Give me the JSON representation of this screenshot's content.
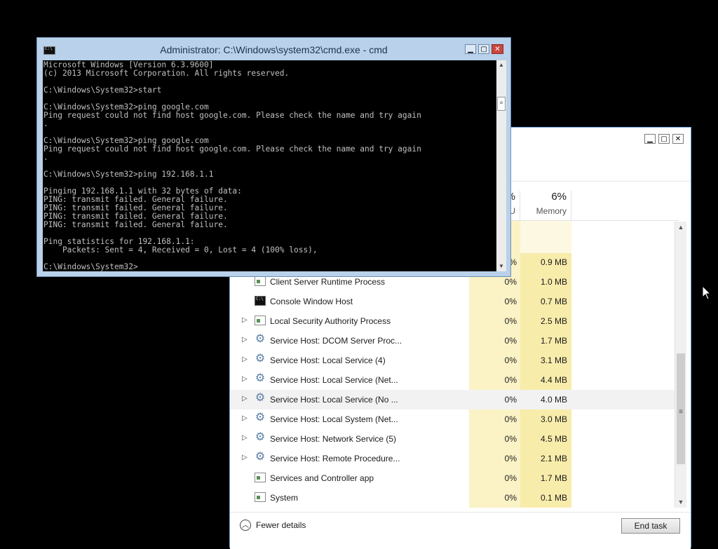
{
  "cmd_window": {
    "title": "Administrator: C:\\Windows\\system32\\cmd.exe - cmd",
    "buttons": {
      "minimize": "▁",
      "maximize": "▢",
      "close": "✕"
    },
    "console_text": "Microsoft Windows [Version 6.3.9600]\n(c) 2013 Microsoft Corporation. All rights reserved.\n\nC:\\Windows\\System32>start\n\nC:\\Windows\\System32>ping google.com\nPing request could not find host google.com. Please check the name and try again\n.\n\nC:\\Windows\\System32>ping google.com\nPing request could not find host google.com. Please check the name and try again\n.\n\nC:\\Windows\\System32>ping 192.168.1.1\n\nPinging 192.168.1.1 with 32 bytes of data:\nPING: transmit failed. General failure.\nPING: transmit failed. General failure.\nPING: transmit failed. General failure.\nPING: transmit failed. General failure.\n\nPing statistics for 192.168.1.1:\n    Packets: Sent = 4, Received = 0, Lost = 4 (100% loss),\n\nC:\\Windows\\System32>",
    "scroll_up": "▲",
    "scroll_down": "▼",
    "scroll_grip": "≡"
  },
  "task_manager": {
    "buttons": {
      "minimize": "▁",
      "maximize": "▢",
      "close": "✕"
    },
    "columns": {
      "cpu": {
        "percent": "%",
        "label": "U"
      },
      "memory": {
        "percent": "6%",
        "label": "Memory"
      }
    },
    "processes": [
      {
        "name": "",
        "cpu": "%",
        "memory": "0.9 MB",
        "icon": "none",
        "expandable": false
      },
      {
        "name": "Client Server Runtime Process",
        "cpu": "0%",
        "memory": "1.0 MB",
        "icon": "window-icon",
        "expandable": false
      },
      {
        "name": "Console Window Host",
        "cpu": "0%",
        "memory": "0.7 MB",
        "icon": "console-icon",
        "expandable": false
      },
      {
        "name": "Local Security Authority Process",
        "cpu": "0%",
        "memory": "2.5 MB",
        "icon": "window-icon",
        "expandable": true
      },
      {
        "name": "Service Host: DCOM Server Proc...",
        "cpu": "0%",
        "memory": "1.7 MB",
        "icon": "gear-icon",
        "expandable": true
      },
      {
        "name": "Service Host: Local Service (4)",
        "cpu": "0%",
        "memory": "3.1 MB",
        "icon": "gear-icon",
        "expandable": true
      },
      {
        "name": "Service Host: Local Service (Net...",
        "cpu": "0%",
        "memory": "4.4 MB",
        "icon": "gear-icon",
        "expandable": true
      },
      {
        "name": "Service Host: Local Service (No ...",
        "cpu": "0%",
        "memory": "4.0 MB",
        "icon": "gear-icon",
        "expandable": true
      },
      {
        "name": "Service Host: Local System (Net...",
        "cpu": "0%",
        "memory": "3.0 MB",
        "icon": "gear-icon",
        "expandable": true
      },
      {
        "name": "Service Host: Network Service (5)",
        "cpu": "0%",
        "memory": "4.5 MB",
        "icon": "gear-icon",
        "expandable": true
      },
      {
        "name": "Service Host: Remote Procedure...",
        "cpu": "0%",
        "memory": "2.1 MB",
        "icon": "gear-icon",
        "expandable": true
      },
      {
        "name": "Services and Controller app",
        "cpu": "0%",
        "memory": "1.7 MB",
        "icon": "window-icon",
        "expandable": false
      },
      {
        "name": "System",
        "cpu": "0%",
        "memory": "0.1 MB",
        "icon": "window-icon",
        "expandable": false
      }
    ],
    "highlighted_row": 7,
    "expander_glyph": "▷",
    "fewer_details_icon": "︿",
    "fewer_details": "Fewer details",
    "end_task": "End task",
    "scroll_up": "▲",
    "scroll_down": "▼",
    "scroll_grip": "≡"
  }
}
